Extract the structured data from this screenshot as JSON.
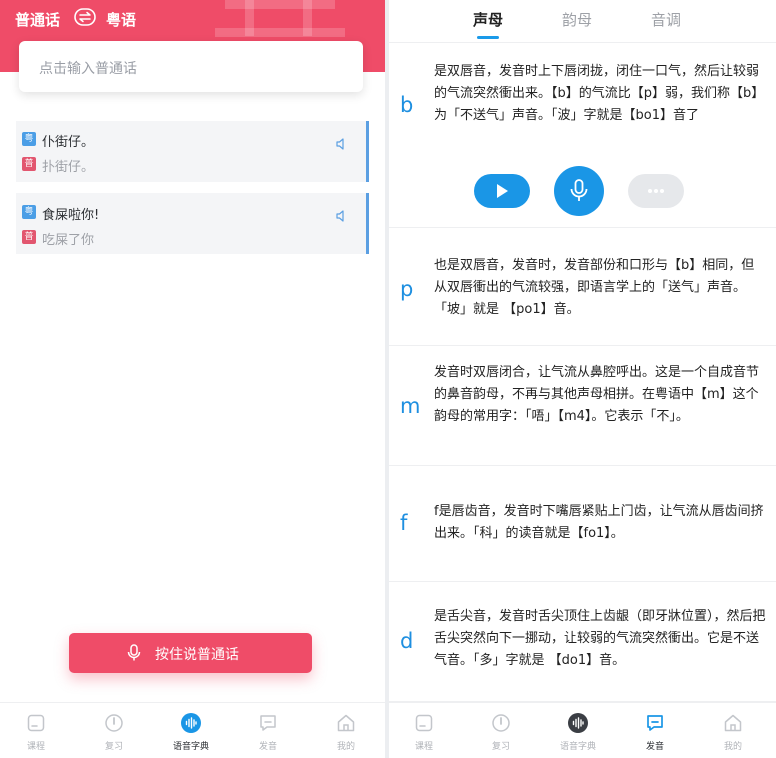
{
  "left": {
    "header": {
      "from_lang": "普通话",
      "to_lang": "粤语",
      "swap_icon": "swap-arrows-icon",
      "bg_color": "#ef4c68"
    },
    "search": {
      "placeholder": "点击输入普通话"
    },
    "translations": [
      {
        "yue_tag": "粤",
        "yue_text": "仆街仔。",
        "pu_tag": "普",
        "pu_text": "扑街仔。"
      },
      {
        "yue_tag": "粤",
        "yue_text": "食屎啦你!",
        "pu_tag": "普",
        "pu_text": "吃屎了你"
      }
    ],
    "hold_button": {
      "label": "按住说普通话",
      "icon": "microphone-icon"
    },
    "tabbar": [
      {
        "label": "课程",
        "icon": "course-icon",
        "active": false
      },
      {
        "label": "复习",
        "icon": "review-icon",
        "active": false
      },
      {
        "label": "语音字典",
        "icon": "voice-dictionary-icon",
        "active": true
      },
      {
        "label": "发音",
        "icon": "pronunciation-icon",
        "active": false
      },
      {
        "label": "我的",
        "icon": "home-icon",
        "active": false
      }
    ]
  },
  "right": {
    "tabs": [
      {
        "label": "声母",
        "selected": true
      },
      {
        "label": "韵母",
        "selected": false
      },
      {
        "label": "音调",
        "selected": false
      }
    ],
    "entries": [
      {
        "letter": "b",
        "desc": "是双唇音，发音时上下唇闭拢，闭住一口气，然后让较弱的气流突然衝出来。【b】的气流比【p】弱，我们称【b】为「不送气」声音。「波」字就是【bo1】音了"
      },
      {
        "letter": "p",
        "desc": "也是双唇音，发音时，发音部份和口形与【b】相同，但从双唇衝出的气流较强，即语言学上的「送气」声音。「坡」就是 【po1】音。"
      },
      {
        "letter": "m",
        "desc": "发音时双唇闭合，让气流从鼻腔呼出。这是一个自成音节的鼻音韵母，不再与其他声母相拼。在粤语中【m】这个韵母的常用字：「唔」【m4】。它表示「不」。"
      },
      {
        "letter": "f",
        "desc": "f是唇齿音，发音时下嘴唇紧贴上门齿，让气流从唇齿间挤出来。「科」的读音就是【fo1】。"
      },
      {
        "letter": "d",
        "desc": "是舌尖音，发音时舌尖顶住上齿龈（即牙牀位置），然后把舌尖突然向下一挪动，让较弱的气流突然衝出。它是不送气音。「多」字就是 【do1】音。"
      }
    ],
    "controls": {
      "play_icon": "play-icon",
      "record_icon": "microphone-icon",
      "more_icon": "more-dots-icon"
    },
    "accent_color": "#1a96e6",
    "tabbar": [
      {
        "label": "课程",
        "icon": "course-icon",
        "active": false
      },
      {
        "label": "复习",
        "icon": "review-icon",
        "active": false
      },
      {
        "label": "语音字典",
        "icon": "voice-dictionary-icon",
        "active": false
      },
      {
        "label": "发音",
        "icon": "pronunciation-icon",
        "active": true
      },
      {
        "label": "我的",
        "icon": "home-icon",
        "active": false
      }
    ]
  }
}
